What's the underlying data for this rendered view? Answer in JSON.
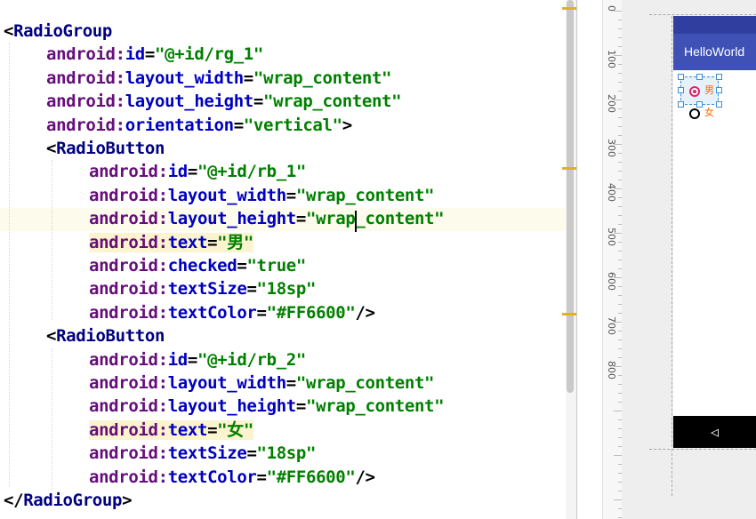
{
  "code": [
    {
      "indent": 0,
      "hl": false,
      "tokens": [
        {
          "t": "<",
          "c": "punct"
        },
        {
          "t": "RadioGroup",
          "c": "tag"
        }
      ]
    },
    {
      "indent": 1,
      "hl": false,
      "tokens": [
        {
          "t": "android:",
          "c": "ns"
        },
        {
          "t": "id",
          "c": "attr"
        },
        {
          "t": "=",
          "c": "punct"
        },
        {
          "t": "\"@+id/rg_1\"",
          "c": "val"
        }
      ]
    },
    {
      "indent": 1,
      "hl": false,
      "tokens": [
        {
          "t": "android:",
          "c": "ns"
        },
        {
          "t": "layout_width",
          "c": "attr"
        },
        {
          "t": "=",
          "c": "punct"
        },
        {
          "t": "\"wrap_content\"",
          "c": "val"
        }
      ]
    },
    {
      "indent": 1,
      "hl": false,
      "tokens": [
        {
          "t": "android:",
          "c": "ns"
        },
        {
          "t": "layout_height",
          "c": "attr"
        },
        {
          "t": "=",
          "c": "punct"
        },
        {
          "t": "\"wrap_content\"",
          "c": "val"
        }
      ]
    },
    {
      "indent": 1,
      "hl": false,
      "tokens": [
        {
          "t": "android:",
          "c": "ns"
        },
        {
          "t": "orientation",
          "c": "attr"
        },
        {
          "t": "=",
          "c": "punct"
        },
        {
          "t": "\"vertical\"",
          "c": "val"
        },
        {
          "t": ">",
          "c": "punct"
        }
      ]
    },
    {
      "indent": 1,
      "hl": false,
      "tokens": [
        {
          "t": "<",
          "c": "punct"
        },
        {
          "t": "RadioButton",
          "c": "tag"
        }
      ]
    },
    {
      "indent": 2,
      "hl": false,
      "tokens": [
        {
          "t": "android:",
          "c": "ns"
        },
        {
          "t": "id",
          "c": "attr"
        },
        {
          "t": "=",
          "c": "punct"
        },
        {
          "t": "\"@+id/rb_1\"",
          "c": "val"
        }
      ]
    },
    {
      "indent": 2,
      "hl": false,
      "tokens": [
        {
          "t": "android:",
          "c": "ns"
        },
        {
          "t": "layout_width",
          "c": "attr"
        },
        {
          "t": "=",
          "c": "punct"
        },
        {
          "t": "\"wrap_content\"",
          "c": "val"
        }
      ]
    },
    {
      "indent": 2,
      "hl": false,
      "tokens": [
        {
          "t": "android:",
          "c": "ns"
        },
        {
          "t": "layout_height",
          "c": "attr"
        },
        {
          "t": "=",
          "c": "punct"
        },
        {
          "t": "\"wrap_content\"",
          "c": "val"
        }
      ]
    },
    {
      "indent": 2,
      "hl": true,
      "tokens": [
        {
          "t": "android:",
          "c": "ns"
        },
        {
          "t": "text",
          "c": "attr"
        },
        {
          "t": "=",
          "c": "punct"
        },
        {
          "t": "\"男\"",
          "c": "val"
        }
      ]
    },
    {
      "indent": 2,
      "hl": false,
      "tokens": [
        {
          "t": "android:",
          "c": "ns"
        },
        {
          "t": "checked",
          "c": "attr"
        },
        {
          "t": "=",
          "c": "punct"
        },
        {
          "t": "\"true\"",
          "c": "val"
        }
      ]
    },
    {
      "indent": 2,
      "hl": false,
      "tokens": [
        {
          "t": "android:",
          "c": "ns"
        },
        {
          "t": "textSize",
          "c": "attr"
        },
        {
          "t": "=",
          "c": "punct"
        },
        {
          "t": "\"18sp\"",
          "c": "val"
        }
      ]
    },
    {
      "indent": 2,
      "hl": false,
      "tokens": [
        {
          "t": "android:",
          "c": "ns"
        },
        {
          "t": "textColor",
          "c": "attr"
        },
        {
          "t": "=",
          "c": "punct"
        },
        {
          "t": "\"#FF6600\"",
          "c": "val"
        },
        {
          "t": "/>",
          "c": "punct"
        }
      ]
    },
    {
      "indent": 1,
      "hl": false,
      "tokens": [
        {
          "t": "<",
          "c": "punct"
        },
        {
          "t": "RadioButton",
          "c": "tag"
        }
      ]
    },
    {
      "indent": 2,
      "hl": false,
      "tokens": [
        {
          "t": "android:",
          "c": "ns"
        },
        {
          "t": "id",
          "c": "attr"
        },
        {
          "t": "=",
          "c": "punct"
        },
        {
          "t": "\"@+id/rb_2\"",
          "c": "val"
        }
      ]
    },
    {
      "indent": 2,
      "hl": false,
      "tokens": [
        {
          "t": "android:",
          "c": "ns"
        },
        {
          "t": "layout_width",
          "c": "attr"
        },
        {
          "t": "=",
          "c": "punct"
        },
        {
          "t": "\"wrap_content\"",
          "c": "val"
        }
      ]
    },
    {
      "indent": 2,
      "hl": false,
      "tokens": [
        {
          "t": "android:",
          "c": "ns"
        },
        {
          "t": "layout_height",
          "c": "attr"
        },
        {
          "t": "=",
          "c": "punct"
        },
        {
          "t": "\"wrap_content\"",
          "c": "val"
        }
      ]
    },
    {
      "indent": 2,
      "hl": true,
      "tokens": [
        {
          "t": "android:",
          "c": "ns"
        },
        {
          "t": "text",
          "c": "attr"
        },
        {
          "t": "=",
          "c": "punct"
        },
        {
          "t": "\"女\"",
          "c": "val"
        }
      ]
    },
    {
      "indent": 2,
      "hl": false,
      "tokens": [
        {
          "t": "android:",
          "c": "ns"
        },
        {
          "t": "textSize",
          "c": "attr"
        },
        {
          "t": "=",
          "c": "punct"
        },
        {
          "t": "\"18sp\"",
          "c": "val"
        }
      ]
    },
    {
      "indent": 2,
      "hl": false,
      "tokens": [
        {
          "t": "android:",
          "c": "ns"
        },
        {
          "t": "textColor",
          "c": "attr"
        },
        {
          "t": "=",
          "c": "punct"
        },
        {
          "t": "\"#FF6600\"",
          "c": "val"
        },
        {
          "t": "/>",
          "c": "punct"
        }
      ]
    },
    {
      "indent": 0,
      "hl": false,
      "tokens": [
        {
          "t": "</",
          "c": "punct"
        },
        {
          "t": "RadioGroup",
          "c": "tag"
        },
        {
          "t": ">",
          "c": "punct"
        }
      ]
    }
  ],
  "ruler": {
    "labels": [
      "0",
      "100",
      "200",
      "300",
      "400",
      "500",
      "600",
      "700",
      "800"
    ]
  },
  "preview": {
    "app_title": "HelloWorld",
    "nav_back_glyph": "◁",
    "radio_1": {
      "label": "男",
      "checked": true
    },
    "radio_2": {
      "label": "女",
      "checked": false
    }
  },
  "colors": {
    "app_bar": "#3f51b5",
    "status_bar": "#303f9f",
    "radio_text": "#FF6600",
    "radio_checked": "#e91e63",
    "marker": "#e3b21a"
  }
}
